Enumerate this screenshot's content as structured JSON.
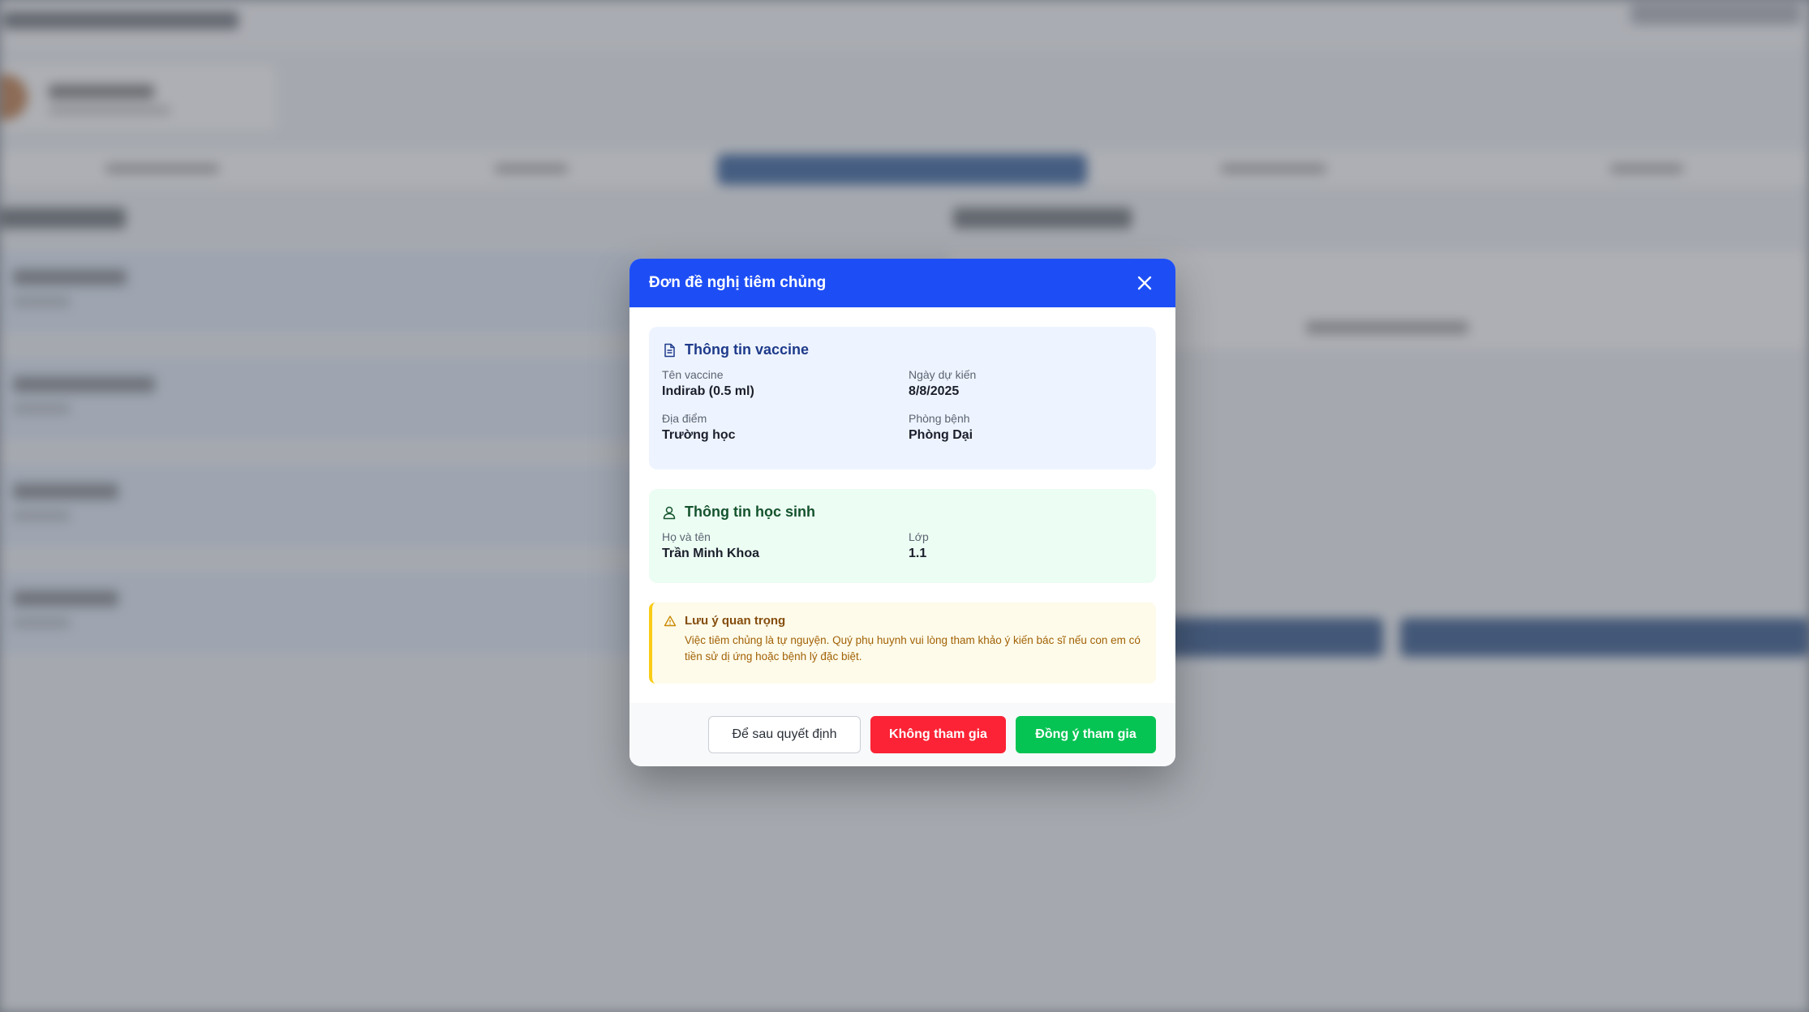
{
  "modal": {
    "title": "Đơn đề nghị tiêm chủng",
    "vaccine_section": {
      "title": "Thông tin vaccine",
      "fields": [
        {
          "label": "Tên vaccine",
          "value": "Indirab (0.5 ml)"
        },
        {
          "label": "Ngày dự kiến",
          "value": "8/8/2025"
        },
        {
          "label": "Địa điểm",
          "value": "Trường học"
        },
        {
          "label": "Phòng bệnh",
          "value": "Phòng Dại"
        }
      ]
    },
    "student_section": {
      "title": "Thông tin học sinh",
      "fields": [
        {
          "label": "Họ và tên",
          "value": "Trần Minh Khoa"
        },
        {
          "label": "Lớp",
          "value": "1.1"
        }
      ]
    },
    "notice": {
      "title": "Lưu ý quan trọng",
      "text": "Việc tiêm chủng là tự nguyện. Quý phụ huynh vui lòng tham khảo ý kiến bác sĩ nếu con em có tiền sử dị ứng hoặc bệnh lý đặc biệt."
    },
    "buttons": {
      "later": "Để sau quyết định",
      "decline": "Không tham gia",
      "accept": "Đồng ý tham gia"
    }
  },
  "colors": {
    "header": "#1d4ef5",
    "decline": "#fb2335",
    "accept": "#06c453",
    "vaccine_bg": "#eef4ff",
    "student_bg": "#ecfdf3",
    "notice_bg": "#fefbea"
  },
  "icons": {
    "close": "close-icon",
    "vaccine": "document-icon",
    "student": "user-icon",
    "notice": "warning-icon"
  }
}
